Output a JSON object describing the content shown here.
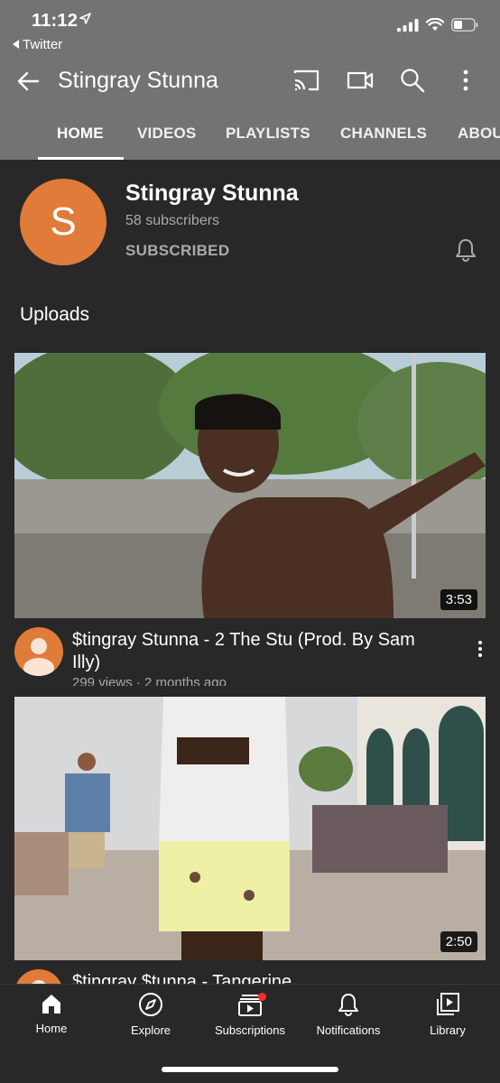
{
  "status": {
    "time": "11:12",
    "back_label": "Twitter",
    "location_icon": "location-arrow-icon",
    "signal_icon": "cellular-signal-icon",
    "wifi_icon": "wifi-icon",
    "battery_icon": "battery-icon"
  },
  "appbar": {
    "title": "Stingray Stunna",
    "icons": [
      "back-arrow-icon",
      "cast-icon",
      "video-camera-icon",
      "search-icon",
      "more-vertical-icon"
    ]
  },
  "tabs": [
    {
      "label": "HOME",
      "active": true
    },
    {
      "label": "VIDEOS",
      "active": false
    },
    {
      "label": "PLAYLISTS",
      "active": false
    },
    {
      "label": "CHANNELS",
      "active": false
    },
    {
      "label": "ABOUT",
      "active": false
    }
  ],
  "channel": {
    "avatar_letter": "S",
    "name": "Stingray Stunna",
    "subscribers": "58 subscribers",
    "subscribed_label": "SUBSCRIBED",
    "avatar_color": "#e07b39"
  },
  "section_title": "Uploads",
  "videos": [
    {
      "title": "$tingray Stunna - 2 The Stu (Prod. By Sam Illy)",
      "meta": "299 views · 2 months ago",
      "duration": "3:53"
    },
    {
      "title": "$tingray $tunna - Tangerine",
      "meta": "",
      "duration": "2:50"
    }
  ],
  "bottom_nav": [
    {
      "label": "Home",
      "icon": "home-icon",
      "active": true
    },
    {
      "label": "Explore",
      "icon": "compass-icon",
      "active": false
    },
    {
      "label": "Subscriptions",
      "icon": "subscriptions-icon",
      "active": false,
      "badge": true
    },
    {
      "label": "Notifications",
      "icon": "bell-icon",
      "active": false
    },
    {
      "label": "Library",
      "icon": "library-icon",
      "active": false
    }
  ],
  "colors": {
    "background": "#282828",
    "header": "#737373",
    "accent": "#e07b39",
    "badge": "#ff2d2d"
  }
}
